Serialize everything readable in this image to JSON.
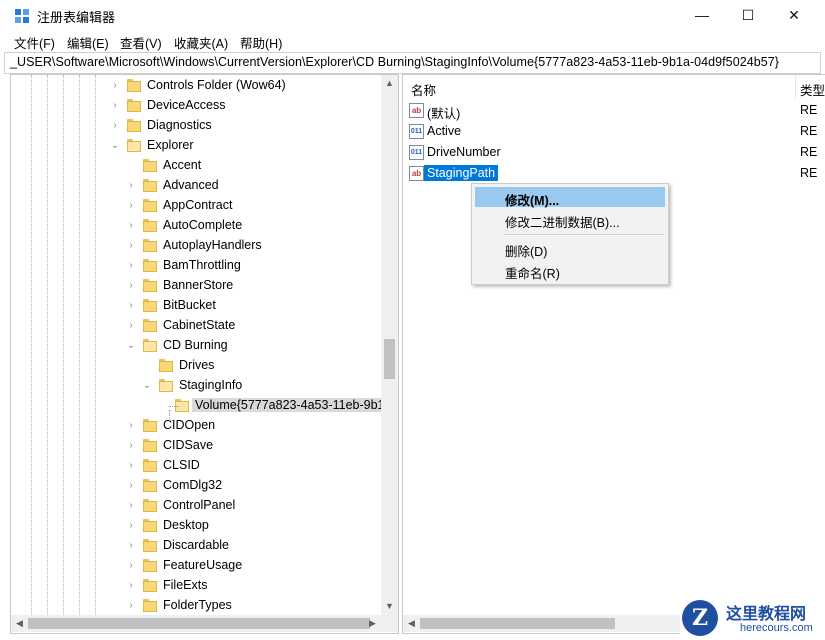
{
  "window": {
    "title": "注册表编辑器",
    "minimize_glyph": "—",
    "maximize_glyph": "☐",
    "close_glyph": "✕"
  },
  "menu": [
    "文件(F)",
    "编辑(E)",
    "查看(V)",
    "收藏夹(A)",
    "帮助(H)"
  ],
  "address": "_USER\\Software\\Microsoft\\Windows\\CurrentVersion\\Explorer\\CD Burning\\StagingInfo\\Volume{5777a823-4a53-11eb-9b1a-04d9f5024b57}",
  "tree": [
    {
      "label": "Controls Folder (Wow64)",
      "level": 0,
      "expander": "right"
    },
    {
      "label": "DeviceAccess",
      "level": 0,
      "expander": "right"
    },
    {
      "label": "Diagnostics",
      "level": 0,
      "expander": "right"
    },
    {
      "label": "Explorer",
      "level": 0,
      "expander": "down"
    },
    {
      "label": "Accent",
      "level": 1,
      "expander": "none"
    },
    {
      "label": "Advanced",
      "level": 1,
      "expander": "right"
    },
    {
      "label": "AppContract",
      "level": 1,
      "expander": "right"
    },
    {
      "label": "AutoComplete",
      "level": 1,
      "expander": "right"
    },
    {
      "label": "AutoplayHandlers",
      "level": 1,
      "expander": "right"
    },
    {
      "label": "BamThrottling",
      "level": 1,
      "expander": "right"
    },
    {
      "label": "BannerStore",
      "level": 1,
      "expander": "right"
    },
    {
      "label": "BitBucket",
      "level": 1,
      "expander": "right"
    },
    {
      "label": "CabinetState",
      "level": 1,
      "expander": "right"
    },
    {
      "label": "CD Burning",
      "level": 1,
      "expander": "down"
    },
    {
      "label": "Drives",
      "level": 2,
      "expander": "none"
    },
    {
      "label": "StagingInfo",
      "level": 2,
      "expander": "down"
    },
    {
      "label": "Volume{5777a823-4a53-11eb-9b1a-04d9f5024b57}",
      "level": 3,
      "expander": "none",
      "selected": true
    },
    {
      "label": "CIDOpen",
      "level": 1,
      "expander": "right"
    },
    {
      "label": "CIDSave",
      "level": 1,
      "expander": "right"
    },
    {
      "label": "CLSID",
      "level": 1,
      "expander": "right"
    },
    {
      "label": "ComDlg32",
      "level": 1,
      "expander": "right"
    },
    {
      "label": "ControlPanel",
      "level": 1,
      "expander": "right"
    },
    {
      "label": "Desktop",
      "level": 1,
      "expander": "right"
    },
    {
      "label": "Discardable",
      "level": 1,
      "expander": "right"
    },
    {
      "label": "FeatureUsage",
      "level": 1,
      "expander": "right"
    },
    {
      "label": "FileExts",
      "level": 1,
      "expander": "right"
    },
    {
      "label": "FolderTypes",
      "level": 1,
      "expander": "right"
    }
  ],
  "list": {
    "columns": {
      "name": "名称",
      "type": "类型"
    },
    "rows": [
      {
        "icon": "string-value-icon",
        "icon_text": "ab",
        "name": "(默认)",
        "type": "RE"
      },
      {
        "icon": "binary-value-icon",
        "icon_text": "011",
        "name": "Active",
        "type": "RE"
      },
      {
        "icon": "binary-value-icon",
        "icon_text": "011",
        "name": "DriveNumber",
        "type": "RE"
      },
      {
        "icon": "string-value-icon",
        "icon_text": "ab",
        "name": "StagingPath",
        "type": "RE",
        "selected": true
      }
    ]
  },
  "context_menu": {
    "modify": "修改(M)...",
    "modify_binary": "修改二进制数据(B)...",
    "delete": "删除(D)",
    "rename": "重命名(R)"
  },
  "watermark": {
    "logo_letter": "Z",
    "text_cn": "这里教程网",
    "text_en": "herecours.com"
  },
  "colors": {
    "selection": "#0078d7",
    "menu_highlight": "#99c9ef",
    "folder": "#f8d775"
  }
}
